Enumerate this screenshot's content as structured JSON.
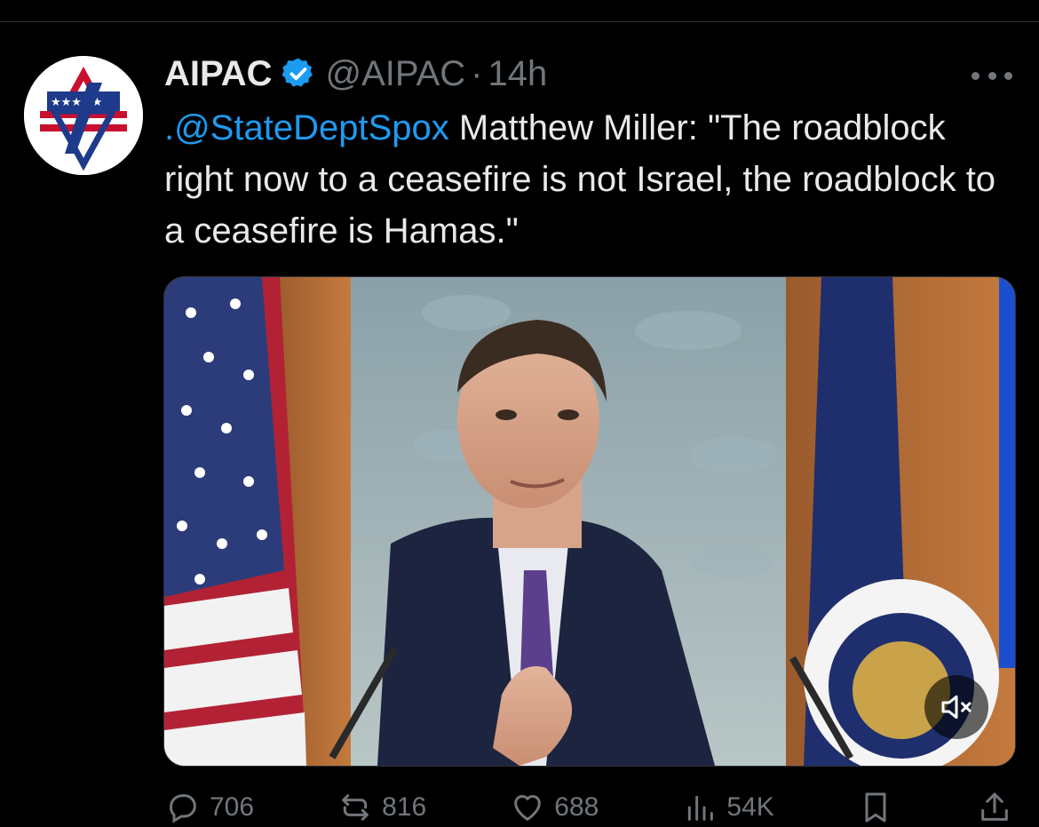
{
  "tweet": {
    "display_name": "AIPAC",
    "handle": "@AIPAC",
    "separator": "·",
    "time": "14h",
    "text_mention": ".@StateDeptSpox",
    "text_body": " Matthew Miller: \"The roadblock right now to a ceasefire is not Israel, the roadblock to a ceasefire is Hamas.\""
  },
  "actions": {
    "replies": "706",
    "reposts": "816",
    "likes": "688",
    "views": "54K"
  },
  "colors": {
    "background": "#000000",
    "text": "#e7e9ea",
    "secondary": "#71767b",
    "link": "#1d9bf0",
    "verified": "#1d9bf0"
  },
  "icons": [
    "verified-badge-icon",
    "more-options-icon",
    "mute-icon",
    "reply-icon",
    "repost-icon",
    "like-icon",
    "views-icon",
    "bookmark-icon",
    "share-icon"
  ]
}
